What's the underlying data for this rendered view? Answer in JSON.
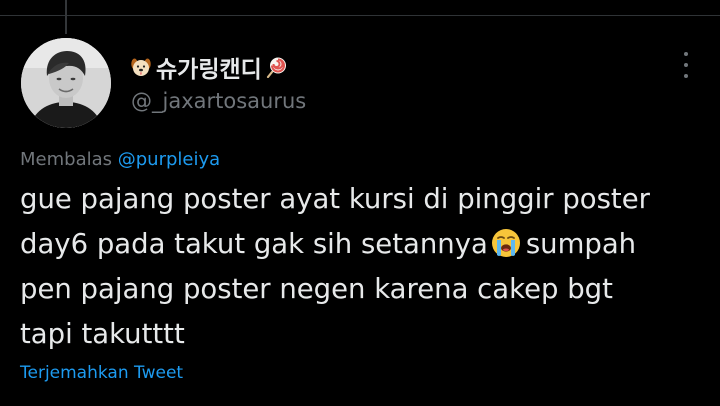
{
  "tweet": {
    "author": {
      "name_prefix_icon": "dog-face-icon",
      "display_name": "슈가링캔디",
      "name_suffix_icon": "lollipop-icon",
      "handle": "@_jaxartosaurus"
    },
    "more_icon": "more-options-icon",
    "reply_to": {
      "prefix": "Membalas",
      "mention": "@purpleiya"
    },
    "text": {
      "line1": "gue pajang poster ayat kursi di pinggir poster",
      "line2_before_emoji": "day6 pada takut gak sih setannya",
      "line2_emoji": "loudly-crying-face-icon",
      "line2_after_emoji": "sumpah",
      "line3": "pen pajang poster negen karena cakep bgt",
      "line4": "tapi takutttt"
    },
    "translate_label": "Terjemahkan Tweet"
  },
  "colors": {
    "background": "#000000",
    "text_primary": "#e7e9ea",
    "text_secondary": "#71767b",
    "accent": "#1d9bf0",
    "divider": "#2f3336"
  }
}
